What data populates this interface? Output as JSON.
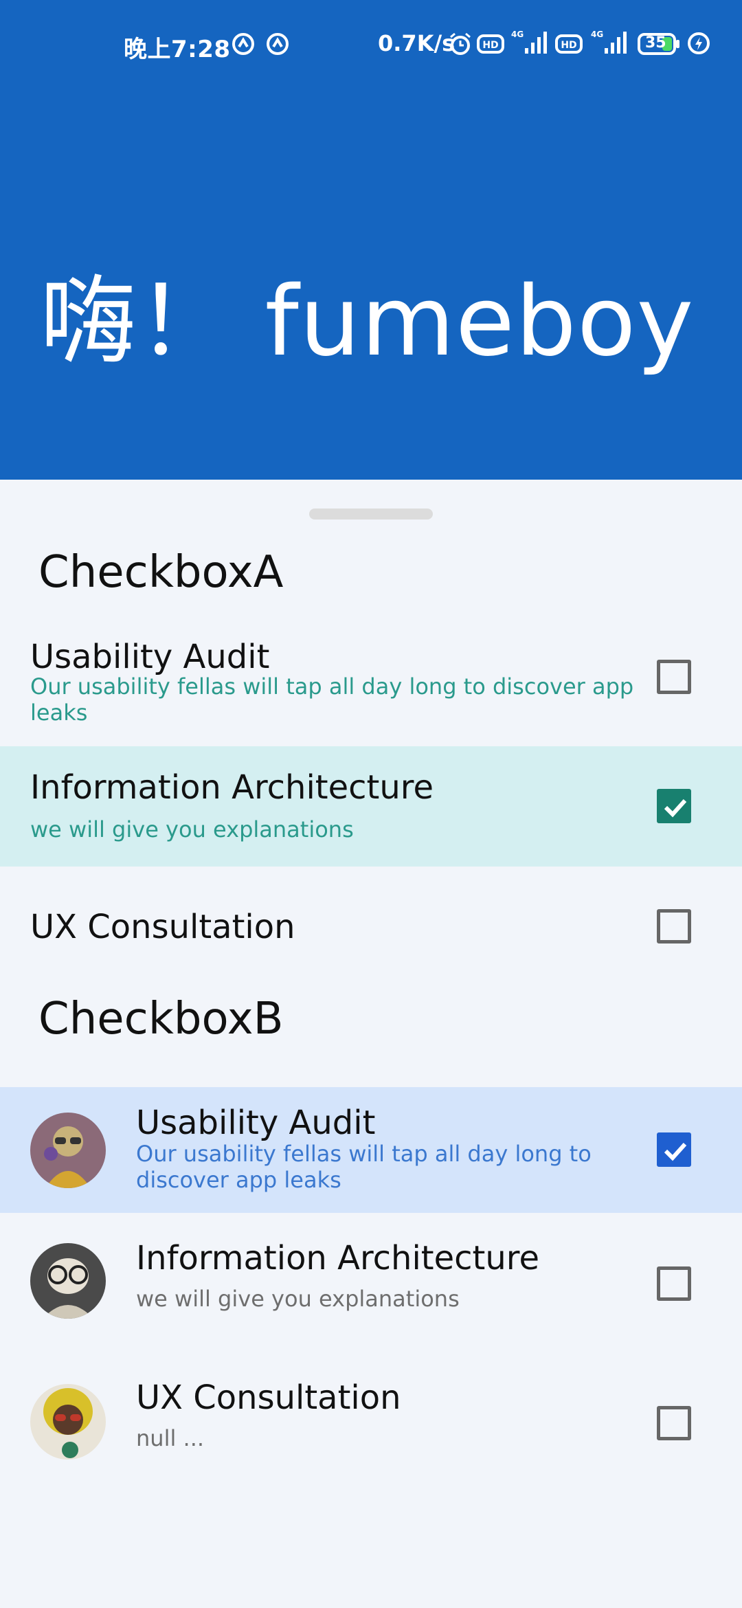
{
  "status_bar": {
    "time": "晚上7:28",
    "net_speed": "0.7K/s",
    "battery": "35"
  },
  "header": {
    "greeting": "嗨！ fumeboy"
  },
  "section_a": {
    "title": "CheckboxA",
    "items": [
      {
        "title": "Usability Audit",
        "subtitle": "Our usability fellas will tap all day long to discover app",
        "subtitle_line2": "leaks",
        "checked": false
      },
      {
        "title": "Information Architecture",
        "subtitle": "we will give you explanations",
        "checked": true
      },
      {
        "title": "UX Consultation",
        "checked": false
      }
    ]
  },
  "section_b": {
    "title": "CheckboxB",
    "items": [
      {
        "title": "Usability Audit",
        "subtitle": "Our usability fellas will tap all day long to",
        "subtitle_line2": "discover app leaks",
        "checked": true
      },
      {
        "title": "Information Architecture",
        "subtitle": "we will give you explanations",
        "checked": false
      },
      {
        "title": "UX Consultation",
        "subtitle": "null ...",
        "checked": false
      }
    ]
  },
  "colors": {
    "header_bg": "#1565c0",
    "sheet_bg": "#f2f5fa",
    "selected_teal_bg": "#d4eff1",
    "selected_blue_bg": "#d4e4fb",
    "teal_accent": "#18806f",
    "blue_accent": "#1f5fd0"
  }
}
